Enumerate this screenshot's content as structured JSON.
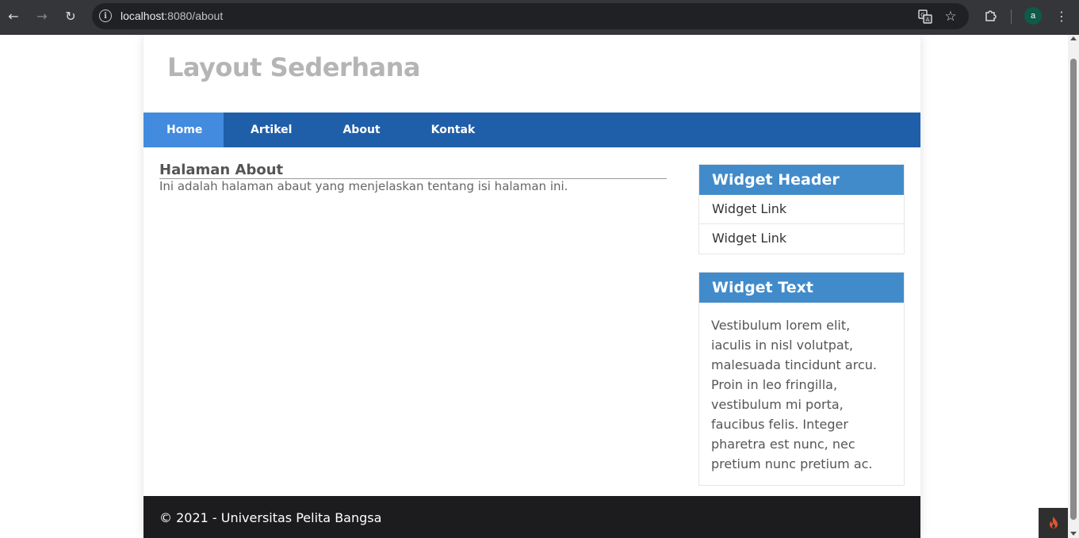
{
  "browser": {
    "url_host": "localhost",
    "url_path": ":8080/about",
    "avatar_letter": "a"
  },
  "site": {
    "title": "Layout Sederhana"
  },
  "nav": {
    "items": [
      {
        "label": "Home",
        "active": true
      },
      {
        "label": "Artikel",
        "active": false
      },
      {
        "label": "About",
        "active": false
      },
      {
        "label": "Kontak",
        "active": false
      }
    ]
  },
  "main": {
    "heading": "Halaman About",
    "body": "Ini adalah halaman abaut yang menjelaskan tentang isi halaman ini."
  },
  "sidebar": {
    "widget_header": {
      "title": "Widget Header",
      "links": [
        "Widget Link",
        "Widget Link"
      ]
    },
    "widget_text": {
      "title": "Widget Text",
      "body": "Vestibulum lorem elit, iaculis in nisl volutpat, malesuada tincidunt arcu. Proin in leo fringilla, vestibulum mi porta, faucibus felis. Integer pharetra est nunc, nec pretium nunc pretium ac."
    }
  },
  "footer": {
    "text": "© 2021 - Universitas Pelita Bangsa"
  },
  "colors": {
    "nav_bg": "#1f5faa",
    "nav_active": "#428bdf",
    "widget_header_bg": "#428bcb",
    "footer_bg": "#1c1c1e"
  },
  "icons": {
    "back": "arrow-left-icon",
    "forward": "arrow-right-icon",
    "reload": "reload-icon",
    "site_info": "info-icon",
    "translate": "translate-icon",
    "bookmark": "star-icon",
    "extensions": "puzzle-icon",
    "menu": "kebab-menu-icon",
    "debug": "flame-icon"
  }
}
